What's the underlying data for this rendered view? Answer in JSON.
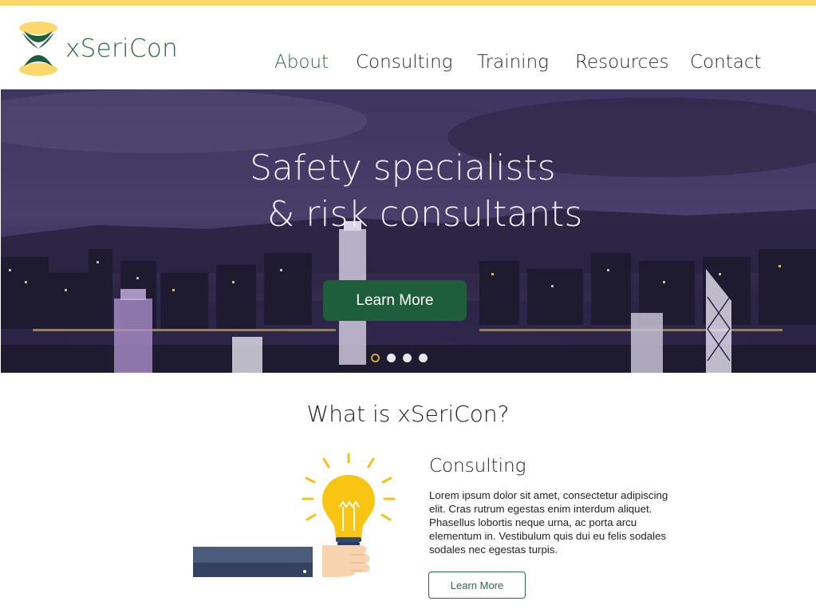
{
  "brand": {
    "name": "xSeriCon",
    "logo_icon": "hourglass-x-logo-icon"
  },
  "nav": {
    "items": [
      {
        "label": "About",
        "active": true
      },
      {
        "label": "Consulting",
        "active": false
      },
      {
        "label": "Training",
        "active": false
      },
      {
        "label": "Resources",
        "active": false
      },
      {
        "label": "Contact",
        "active": false
      }
    ]
  },
  "hero": {
    "title_line1": "Safety specialists",
    "title_line2": "& risk consultants",
    "cta_label": "Learn More",
    "slides": {
      "count": 4,
      "active_index": 0
    }
  },
  "about": {
    "heading": "What is xSeriCon?",
    "card": {
      "icon": "lightbulb-hand-icon",
      "title": "Consulting",
      "body": "Lorem ipsum dolor sit amet, consectetur adipiscing elit. Cras rutrum egestas enim interdum aliquet. Phasellus lobortis neque urna, ac porta arcu elementum in. Vestibulum quis dui eu felis sodales sodales nec egestas turpis.",
      "button_label": "Learn More"
    }
  },
  "colors": {
    "accent_yellow": "#fcd76b",
    "brand_green": "#2d6a45",
    "button_green": "#1f5e3a",
    "hero_tint": "#3b2f5c"
  }
}
